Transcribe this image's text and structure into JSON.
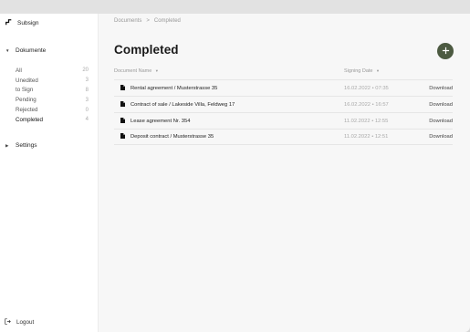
{
  "app": {
    "name": "Subsign"
  },
  "sidebar": {
    "documents_label": "Dokumente",
    "items": [
      {
        "label": "All",
        "count": "20"
      },
      {
        "label": "Unedited",
        "count": "3"
      },
      {
        "label": "to Sign",
        "count": "8"
      },
      {
        "label": "Pending",
        "count": "3"
      },
      {
        "label": "Rejected",
        "count": "0"
      },
      {
        "label": "Completed",
        "count": "4"
      }
    ],
    "settings_label": "Settings",
    "logout_label": "Logout"
  },
  "breadcrumb": {
    "root": "Documents",
    "separator": ">",
    "current": "Completed"
  },
  "page": {
    "title": "Completed"
  },
  "table": {
    "col_name": "Document Name",
    "col_date": "Signing Date",
    "rows": [
      {
        "name": "Rental agreement / Musterstrasse 35",
        "date": "16.02.2022 • 07:35",
        "action": "Download"
      },
      {
        "name": "Contract of sale / Lakeside Villa, Feldweg 17",
        "date": "16.02.2022 • 16:57",
        "action": "Download"
      },
      {
        "name": "Lease agreement Nr. 354",
        "date": "11.02.2022 • 12:55",
        "action": "Download"
      },
      {
        "name": "Deposit contract / Musterstrasse 35",
        "date": "11.02.2022 • 12:51",
        "action": "Download"
      }
    ]
  },
  "colors": {
    "accent": "#4c5a41",
    "sidebar_bg": "#ffffff",
    "main_bg": "#f7f7f7"
  }
}
